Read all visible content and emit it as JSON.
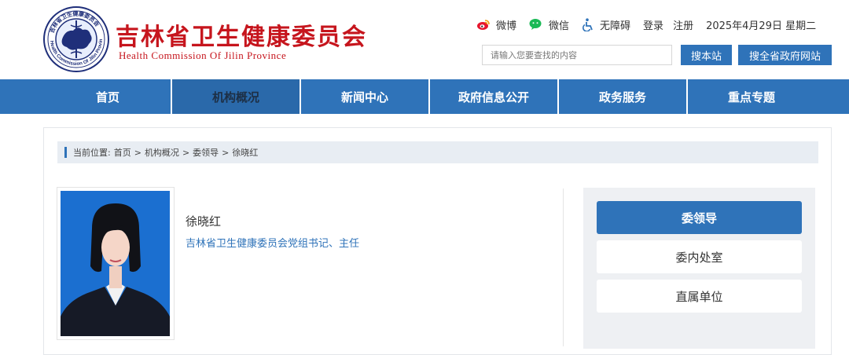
{
  "header": {
    "title": "吉林省卫生健康委员会",
    "subtitle": "Health Commission Of Jilin Province",
    "logo_text": "Health Commission Of Jilin Province",
    "logo_text_cn": "吉林省卫生健康委员会",
    "links": {
      "weibo": "微博",
      "wechat": "微信",
      "accessibility": "无障碍",
      "login": "登录",
      "register": "注册"
    },
    "date": "2025年4月29日 星期二",
    "search_placeholder": "请输入您要查找的内容",
    "search_site_label": "搜本站",
    "search_gov_label": "搜全省政府网站"
  },
  "nav": {
    "items": [
      {
        "label": "首页"
      },
      {
        "label": "机构概况"
      },
      {
        "label": "新闻中心"
      },
      {
        "label": "政府信息公开"
      },
      {
        "label": "政务服务"
      },
      {
        "label": "重点专题"
      }
    ],
    "active_index": 1
  },
  "breadcrumb": {
    "prefix": "当前位置:",
    "items": [
      "首页",
      "机构概况",
      "委领导",
      "徐晓红"
    ],
    "separator": ">"
  },
  "person": {
    "name": "徐晓红",
    "position": "吉林省卫生健康委员会党组书记、主任"
  },
  "sidebar": {
    "items": [
      {
        "label": "委领导",
        "active": true
      },
      {
        "label": "委内处室",
        "active": false
      },
      {
        "label": "直属单位",
        "active": false
      }
    ]
  },
  "colors": {
    "brand_red": "#c6151d",
    "nav_blue": "#2f73b9",
    "accent_green": "#19b955",
    "weibo_red": "#e6162d"
  }
}
